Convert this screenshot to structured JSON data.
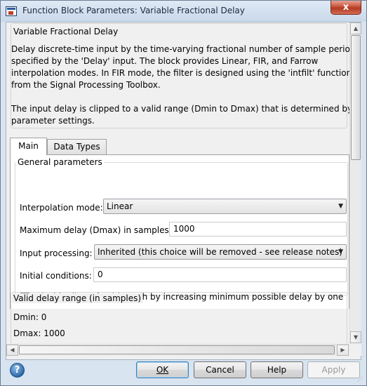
{
  "window": {
    "title": "Function Block Parameters: Variable Fractional Delay",
    "close_glyph": "x"
  },
  "description": {
    "block_name": "Variable Fractional Delay",
    "paragraph1": [
      "Delay discrete-time input by the time-varying fractional number of sample periods",
      "specified by the 'Delay' input. The block provides Linear, FIR, and Farrow",
      "interpolation modes. In FIR mode, the filter is designed using the 'intfilt' function",
      "from the Signal Processing Toolbox."
    ],
    "paragraph2": [
      "The input delay is clipped to a valid range (Dmin to Dmax) that is determined by the",
      "parameter settings."
    ]
  },
  "tabs": [
    {
      "label": "Main",
      "active": true
    },
    {
      "label": "Data Types",
      "active": false
    }
  ],
  "general_parameters": {
    "group_label": "General parameters",
    "interpolation_mode": {
      "label": "Interpolation mode:",
      "value": "Linear"
    },
    "maximum_delay": {
      "label": "Maximum delay (Dmax) in samples:",
      "value": "1000"
    },
    "input_processing": {
      "label": "Input processing:",
      "value": "Inherited (this choice will be removed - see release notes)"
    },
    "initial_conditions": {
      "label": "Initial conditions:",
      "value": "0"
    },
    "disable_feedthrough": {
      "label": "Disable direct feedthrough by increasing minimum possible delay by one",
      "checked": false
    }
  },
  "valid_delay_range": {
    "group_label": "Valid delay range (in samples)",
    "dmin": "Dmin: 0",
    "dmax": "Dmax: 1000"
  },
  "footer": {
    "ok": "OK",
    "cancel": "Cancel",
    "help": "Help",
    "apply": "Apply",
    "help_icon_glyph": "?"
  },
  "icons": {
    "app": "simulink-block-icon",
    "help": "question-mark-icon",
    "dropdown": "chevron-down-icon"
  },
  "colors": {
    "accent_ok_border": "#3c7fb1",
    "window_frame": "#d9e4f1",
    "close_button": "#c7533a"
  }
}
